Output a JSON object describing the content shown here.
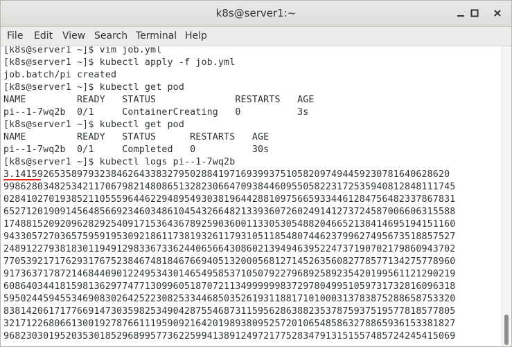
{
  "window": {
    "title": "k8s@server1:~"
  },
  "menu": [
    "File",
    "Edit",
    "View",
    "Search",
    "Terminal",
    "Help"
  ],
  "terminal": {
    "lines": [
      "[k8s@server1 ~]$ vim job.yml",
      "[k8s@server1 ~]$ kubectl apply -f job.yml",
      "job.batch/pi created",
      "[k8s@server1 ~]$ kubectl get pod",
      "NAME         READY   STATUS              RESTARTS   AGE",
      "pi--1-7wq2b  0/1     ContainerCreating   0          3s",
      "[k8s@server1 ~]$ kubectl get pod",
      "NAME         READY   STATUS      RESTARTS   AGE",
      "pi--1-7wq2b  0/1     Completed   0          30s",
      "[k8s@server1 ~]$ kubectl logs pi--1-7wq2b",
      "3.14159265358979323846264338327950288419716939937510582097494459230781640628620",
      "99862803482534211706798214808651328230664709384460955058223172535940812848111745",
      "02841027019385211055596446229489549303819644288109756659334461284756482337867831",
      "65271201909145648566923460348610454326648213393607260249141273724587006606315588",
      "17488152092096282925409171536436789259036001133053054882046652138414695194151160",
      "94330572703657595919530921861173819326117931051185480744623799627495673518857527",
      "24891227938183011949129833673362440656643086021394946395224737190702179860943702",
      "77053921717629317675238467481846766940513200056812714526356082778577134275778960",
      "91736371787214684409012249534301465495853710507922796892589235420199561121290219",
      "60864034418159813629774771309960518707211349999998372978049951059731732816096318",
      "59502445945534690830264252230825334468503526193118817101000313783875288658753320",
      "83814206171776691473035982534904287554687311595628638823537875937519577818577805",
      "32171226806613001927876611195909216420198938095257201065485863278865936153381827",
      "96823030195203530185296899577362259941389124972177528347913151557485724245415069"
    ]
  }
}
